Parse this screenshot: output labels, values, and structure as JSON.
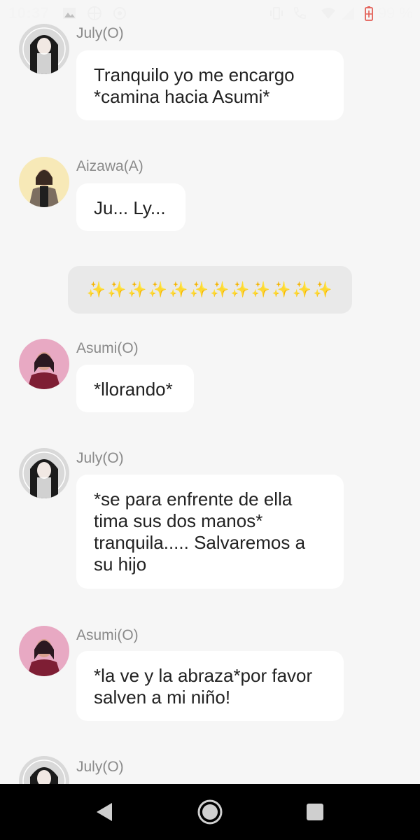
{
  "status_bar": {
    "time": "10:37",
    "battery_percent": "99 %"
  },
  "messages": [
    {
      "sender": "July(O)",
      "text": "Tranquilo yo me encargo *camina hacia Asumi*"
    },
    {
      "sender": "Aizawa(A)",
      "text": "Ju... Ly..."
    },
    {
      "sender": "Asumi(O)",
      "text": "*llorando*"
    },
    {
      "sender": "July(O)",
      "text": "*se para enfrente de ella tima sus dos manos* tranquila..... Salvaremos a su hijo"
    },
    {
      "sender": "Asumi(O)",
      "text": "*la ve y la abraza*por favor salven a mi niño!"
    },
    {
      "sender": "July(O)",
      "text": ""
    }
  ],
  "separator": {
    "text": "✨✨✨✨✨✨✨✨✨✨✨✨"
  },
  "nav_bar": {
    "icons": [
      "back-icon",
      "home-icon",
      "recents-icon"
    ]
  },
  "colors": {
    "background": "#f6f6f6",
    "bubble": "#ffffff",
    "sender": "#8a8a8a",
    "separator_bg": "#e9e9e9",
    "sparkle": "#f2c21b"
  }
}
